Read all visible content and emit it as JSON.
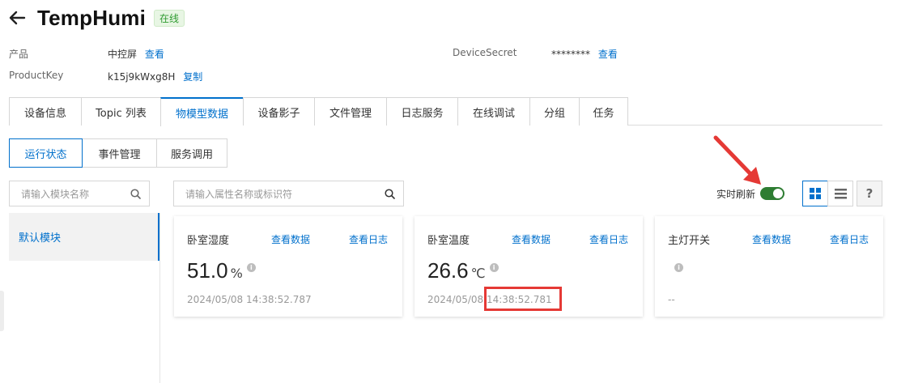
{
  "header": {
    "title": "TempHumi",
    "status": "在线"
  },
  "info": {
    "product_label": "产品",
    "product_value": "中控屏",
    "product_link": "查看",
    "key_label": "ProductKey",
    "key_value": "k15j9kWxg8H",
    "key_link": "复制",
    "secret_label": "DeviceSecret",
    "secret_value": "********",
    "secret_link": "查看"
  },
  "tabs": [
    "设备信息",
    "Topic 列表",
    "物模型数据",
    "设备影子",
    "文件管理",
    "日志服务",
    "在线调试",
    "分组",
    "任务"
  ],
  "subtabs": [
    "运行状态",
    "事件管理",
    "服务调用"
  ],
  "module_search": {
    "placeholder": "请输入模块名称"
  },
  "property_search": {
    "placeholder": "请输入属性名称或标识符"
  },
  "sidebar": {
    "items": [
      "默认模块"
    ]
  },
  "realtime": {
    "label": "实时刷新",
    "enabled": true,
    "toggle_color": "#2e7d32"
  },
  "help": {
    "label": "?"
  },
  "cards": [
    {
      "name": "卧室湿度",
      "view_data": "查看数据",
      "view_log": "查看日志",
      "value": "51.0",
      "unit": "%",
      "time": "2024/05/08 14:38:52.787"
    },
    {
      "name": "卧室温度",
      "view_data": "查看数据",
      "view_log": "查看日志",
      "value": "26.6",
      "unit": "℃",
      "time": "2024/05/08 14:38:52.781"
    },
    {
      "name": "主灯开关",
      "view_data": "查看数据",
      "view_log": "查看日志",
      "value": "",
      "unit": "",
      "time": "--"
    }
  ],
  "colors": {
    "accent": "#0070cc",
    "online": "#2f9b31",
    "highlight": "#e53935"
  }
}
